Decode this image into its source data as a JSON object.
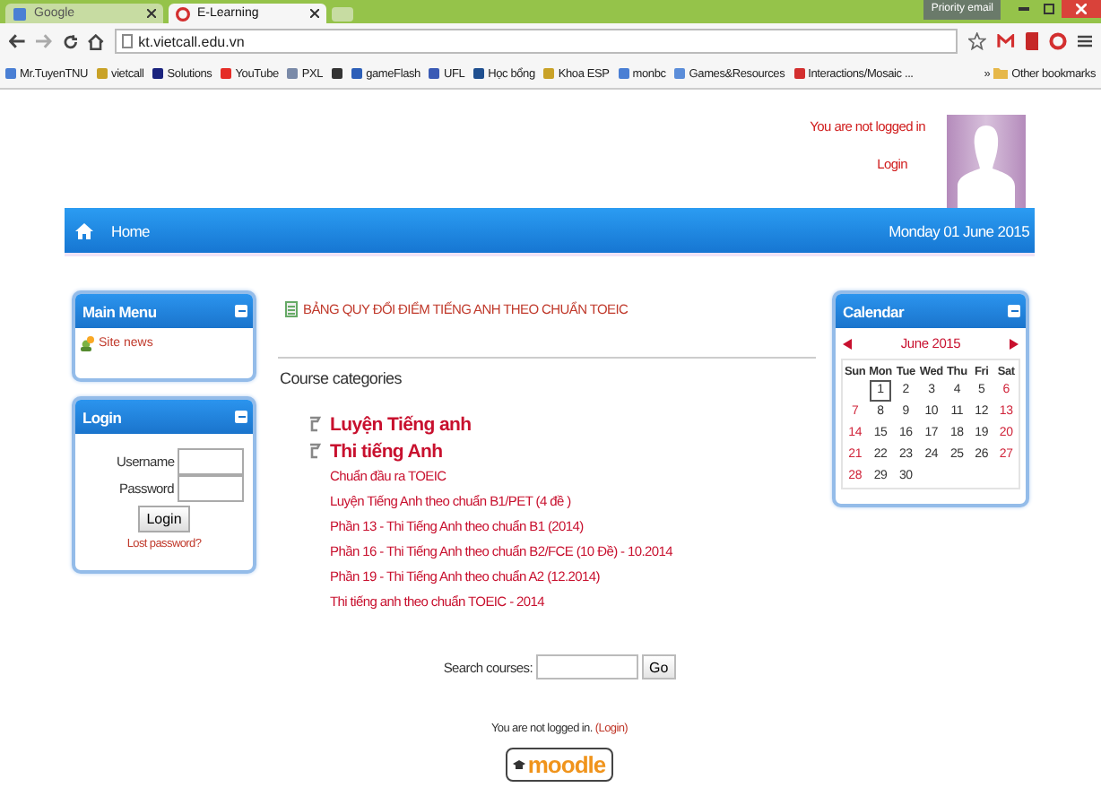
{
  "browser": {
    "tabs": [
      {
        "label": "Google",
        "selected": false
      },
      {
        "label": "E-Learning",
        "selected": true
      }
    ],
    "profile_badge": "Priority email",
    "url": "kt.vietcall.edu.vn",
    "bookmarks": [
      {
        "label": "Mr.TuyenTNU",
        "color": "#4a7fd4"
      },
      {
        "label": "vietcall",
        "color": "#c9a227"
      },
      {
        "label": "Solutions",
        "color": "#1a237e"
      },
      {
        "label": "YouTube",
        "color": "#e52d27"
      },
      {
        "label": "PXL",
        "color": "#7a8aa8"
      },
      {
        "color": "#333333"
      },
      {
        "label": "gameFlash",
        "color": "#2d5fb8"
      },
      {
        "label": "UFL",
        "color": "#3b5bb5"
      },
      {
        "label": "Học bổng",
        "color": "#1f4f8f"
      },
      {
        "label": "Khoa ESP",
        "color": "#c9a227"
      },
      {
        "label": "monbc",
        "color": "#4a7fd4"
      },
      {
        "label": "Games&Resources",
        "color": "#5b8dd9"
      },
      {
        "label": "Interactions/Mosaic ...",
        "color": "#d32f2f"
      }
    ],
    "overflow": "»",
    "other_bookmarks": "Other bookmarks"
  },
  "header": {
    "login_status": "You are not logged in",
    "login_link": "Login"
  },
  "navbar": {
    "home": "Home",
    "date": "Monday 01 June 2015"
  },
  "main_menu": {
    "title": "Main Menu",
    "items": [
      "Site news"
    ]
  },
  "login_block": {
    "title": "Login",
    "username_label": "Username",
    "password_label": "Password",
    "button": "Login",
    "lost_password": "Lost password?"
  },
  "notice": "BẢNG QUY ĐỔI ĐIỂM TIẾNG ANH THEO CHUẨN TOEIC",
  "course_categories": {
    "title": "Course categories",
    "categories": [
      {
        "name": "Luyện Tiếng anh"
      },
      {
        "name": "Thi tiếng Anh",
        "children": [
          {
            "name": "Chuẩn đầu ra TOEIC"
          },
          {
            "name": "Luyện Tiếng Anh theo chuẩn B1/PET (4 đề )"
          },
          {
            "name": "Phần 13 - Thi Tiếng Anh theo chuẩn B1 (2014)"
          },
          {
            "name": "Phần 16 - Thi Tiếng Anh theo chuẩn B2/FCE (10 Đề) - 10.2014"
          },
          {
            "name": "Phần 19 - Thi Tiếng Anh theo chuẩn A2 (12.2014)"
          },
          {
            "name": "Thi tiếng anh theo chuẩn TOEIC - 2014"
          }
        ]
      }
    ]
  },
  "calendar": {
    "title": "Calendar",
    "month": "June 2015",
    "weekdays": [
      "Sun",
      "Mon",
      "Tue",
      "Wed",
      "Thu",
      "Fri",
      "Sat"
    ],
    "weeks": [
      [
        {
          "day": "1",
          "today": true
        },
        {
          "day": "2",
          "today": false
        },
        {
          "day": "3",
          "today": false
        },
        {
          "day": "4",
          "today": false
        },
        {
          "day": "5",
          "today": false
        },
        {
          "day": "6",
          "today": false
        }
      ],
      [
        {
          "day": "7",
          "today": false
        },
        {
          "day": "8",
          "today": false
        },
        {
          "day": "9",
          "today": false
        },
        {
          "day": "10",
          "today": false
        },
        {
          "day": "11",
          "today": false
        },
        {
          "day": "12",
          "today": false
        },
        {
          "day": "13",
          "today": false
        }
      ],
      [
        {
          "day": "14",
          "today": false
        },
        {
          "day": "15",
          "today": false
        },
        {
          "day": "16",
          "today": false
        },
        {
          "day": "17",
          "today": false
        },
        {
          "day": "18",
          "today": false
        },
        {
          "day": "19",
          "today": false
        },
        {
          "day": "20",
          "today": false
        }
      ],
      [
        {
          "day": "21",
          "today": false
        },
        {
          "day": "22",
          "today": false
        },
        {
          "day": "23",
          "today": false
        },
        {
          "day": "24",
          "today": false
        },
        {
          "day": "25",
          "today": false
        },
        {
          "day": "26",
          "today": false
        },
        {
          "day": "27",
          "today": false
        }
      ],
      [
        {
          "day": "28",
          "today": false
        },
        {
          "day": "29",
          "today": false
        },
        {
          "day": "30",
          "today": false
        }
      ]
    ]
  },
  "search": {
    "label": "Search courses:",
    "button": "Go"
  },
  "footer": {
    "status": "You are not logged in.",
    "login_link": "(Login)",
    "logo_text": "moodle"
  }
}
